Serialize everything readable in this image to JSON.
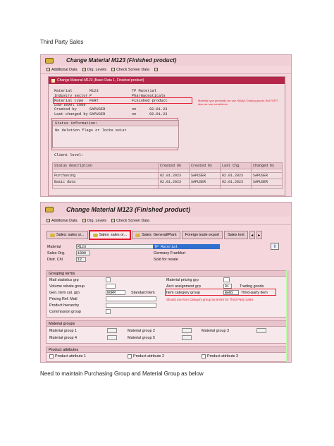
{
  "doc": {
    "heading": "Third Party Sales",
    "caption": "Need to maintain Purchasing Group and Material Group as below"
  },
  "toolbar": {
    "additional_data": "Additional Data",
    "org_levels": "Org. Levels",
    "check_screen": "Check Screen Data"
  },
  "shot1": {
    "title": "Change Material M123 (Finished product)",
    "popup_title": "Change Material M123 (Basic Data 1, Finished product)",
    "rows": [
      {
        "label": "Material",
        "v1": "M123",
        "v2": "TP Material",
        "v3": ""
      },
      {
        "label": "Industry sector",
        "v1": "P",
        "v2": "Pharmaceuticals",
        "v3": ""
      },
      {
        "label": "Material type",
        "v1": "FERT",
        "v2": "Finished product",
        "v3": ""
      },
      {
        "label": "Low-level code",
        "v1": "",
        "v2": "",
        "v3": ""
      },
      {
        "label": "Created by",
        "v1": "SAPUSER",
        "v2": "on",
        "v3": "02.01.23"
      },
      {
        "label": "Last changed by",
        "v1": "SAPUSER",
        "v2": "on",
        "v3": "02.01.23"
      }
    ],
    "note": "Material type generally we use HAWA-Trading goods. But FERT also we use sometimes.",
    "status_heading": "Status information:",
    "status_text": "No deletion flags or locks exist",
    "client_level": "Client level:",
    "table": {
      "headers": [
        "Status description",
        "Created On",
        "Created by",
        "Last Chg.",
        "Changed by"
      ],
      "rows": [
        [
          "Purchasing",
          "02.01.2023",
          "SAPUSER",
          "02.01.2023",
          "SAPUSER"
        ],
        [
          "Basic data",
          "02.01.2023",
          "SAPUSER",
          "02.01.2023",
          "SAPUSER"
        ]
      ]
    }
  },
  "shot2": {
    "title": "Change Material M123 (Finished product)",
    "tabs": [
      "Sales: sales or...",
      "Sales: sales or...",
      "Sales: General/Plant",
      "Foreign trade export",
      "Sales text"
    ],
    "material_label": "Material",
    "material_code": "M123",
    "material_desc": "TP Material",
    "sales_org_label": "Sales Org.",
    "sales_org_code": "1000",
    "sales_org_desc": "Germany Frankfurt",
    "distr_label": "Distr. Chl",
    "distr_code": "12",
    "distr_desc": "Sold for resale",
    "grouping_heading": "Grouping terms",
    "grouping_left": [
      "Matl statistics grp",
      "Volume rebate group",
      "Gen. item cat. grp",
      "Pricing Ref. Matl",
      "Product hierarchy",
      "Commission group"
    ],
    "gen_item_value": "NORM",
    "gen_item_desc": "Standard item",
    "grouping_right": [
      "Material pricing grp",
      "Acct assignment grp",
      "Item category group"
    ],
    "acct_value": "01",
    "acct_desc": "Trading goods",
    "item_cat_value": "BANS",
    "item_cat_desc": "Third-party item",
    "note": "Should use Item Category group as BANS for Third Party Sales",
    "matgroups_heading": "Material groups",
    "matgroups": [
      "Material group 1",
      "Material group 2",
      "Material group 3",
      "Material group 4",
      "Material group 5"
    ],
    "product_attr_heading": "Product attributes",
    "product_attrs": [
      "Product attribute 1",
      "Product attribute 2",
      "Product attribute 3"
    ]
  },
  "colors": {
    "sap_background": "#f4d6dc",
    "popup_bar": "#b5274a",
    "highlight_red": "#e31b2f",
    "selection_blue": "#2f6fce"
  }
}
